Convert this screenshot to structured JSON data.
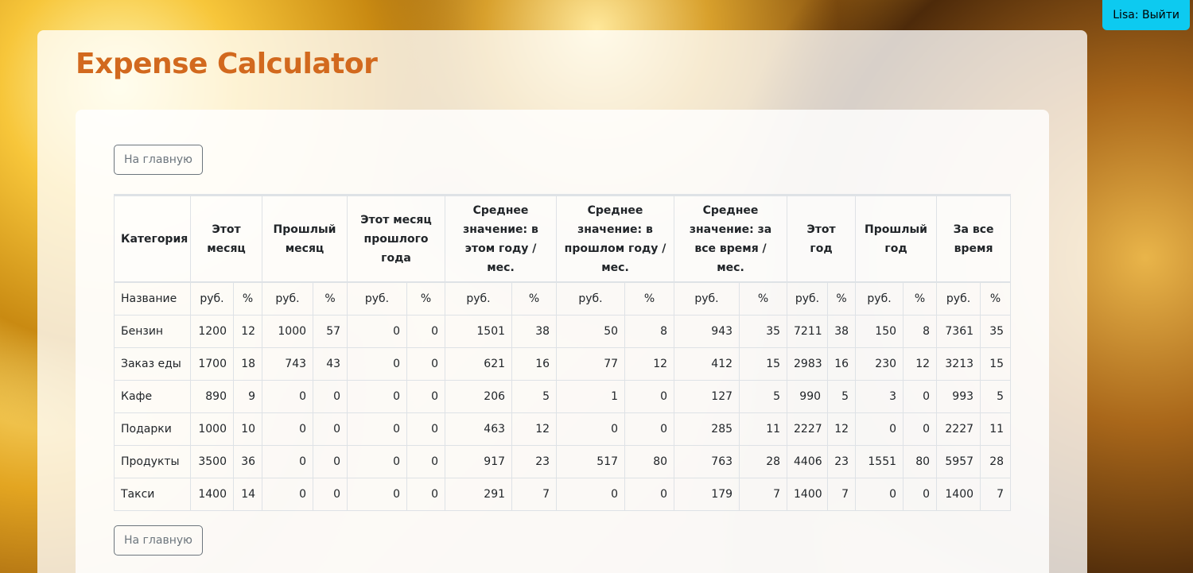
{
  "header": {
    "logout_label": "Lisa: Выйти"
  },
  "app": {
    "title": "Expense Calculator",
    "home_label": "На главную"
  },
  "table": {
    "columns": [
      "Категория",
      "Этот месяц",
      "Прошлый месяц",
      "Этот месяц прошлого года",
      "Среднее значение: в этом году / мес.",
      "Среднее значение: в прошлом году / мес.",
      "Среднее значение: за все время / мес.",
      "Этот год",
      "Прошлый год",
      "За все время"
    ],
    "units": {
      "name": "Название",
      "rub": "руб.",
      "pct": "%"
    },
    "rows": [
      {
        "name": "Бензин",
        "cells": [
          "1200",
          "12",
          "1000",
          "57",
          "0",
          "0",
          "1501",
          "38",
          "50",
          "8",
          "943",
          "35",
          "7211",
          "38",
          "150",
          "8",
          "7361",
          "35"
        ]
      },
      {
        "name": "Заказ еды",
        "cells": [
          "1700",
          "18",
          "743",
          "43",
          "0",
          "0",
          "621",
          "16",
          "77",
          "12",
          "412",
          "15",
          "2983",
          "16",
          "230",
          "12",
          "3213",
          "15"
        ]
      },
      {
        "name": "Кафе",
        "cells": [
          "890",
          "9",
          "0",
          "0",
          "0",
          "0",
          "206",
          "5",
          "1",
          "0",
          "127",
          "5",
          "990",
          "5",
          "3",
          "0",
          "993",
          "5"
        ]
      },
      {
        "name": "Подарки",
        "cells": [
          "1000",
          "10",
          "0",
          "0",
          "0",
          "0",
          "463",
          "12",
          "0",
          "0",
          "285",
          "11",
          "2227",
          "12",
          "0",
          "0",
          "2227",
          "11"
        ]
      },
      {
        "name": "Продукты",
        "cells": [
          "3500",
          "36",
          "0",
          "0",
          "0",
          "0",
          "917",
          "23",
          "517",
          "80",
          "763",
          "28",
          "4406",
          "23",
          "1551",
          "80",
          "5957",
          "28"
        ]
      },
      {
        "name": "Такси",
        "cells": [
          "1400",
          "14",
          "0",
          "0",
          "0",
          "0",
          "291",
          "7",
          "0",
          "0",
          "179",
          "7",
          "1400",
          "7",
          "0",
          "0",
          "1400",
          "7"
        ]
      }
    ]
  },
  "colors": {
    "title": "#d2691e",
    "logout_bg": "#0dcaf0",
    "button_border": "#6c757d"
  }
}
